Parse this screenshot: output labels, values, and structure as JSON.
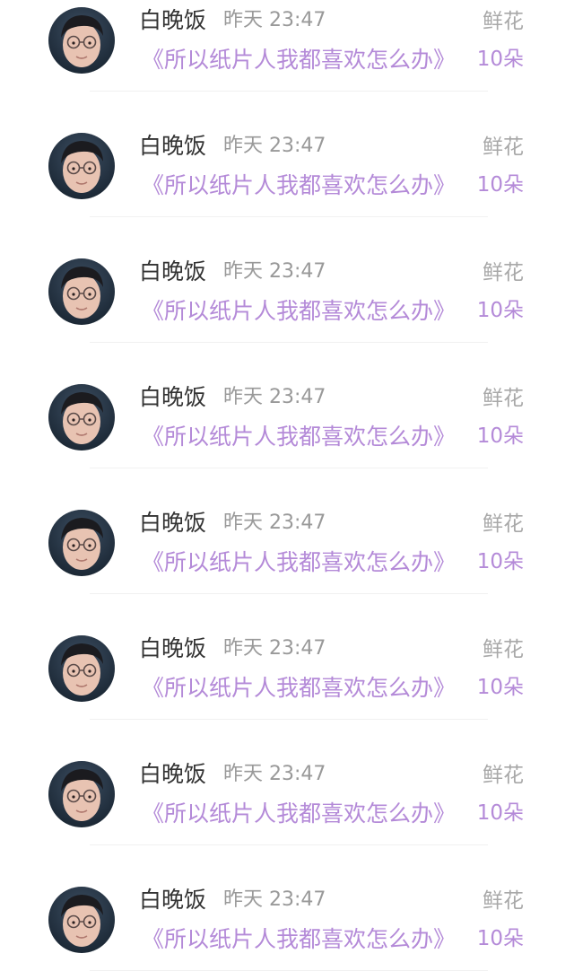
{
  "records": [
    {
      "user": "白晚饭",
      "time": "昨天 23:47",
      "book": "《所以纸片人我都喜欢怎么办》",
      "gift_label": "鲜花",
      "gift_count": "10朵",
      "avatar_icon": "user-avatar-icon"
    },
    {
      "user": "白晚饭",
      "time": "昨天 23:47",
      "book": "《所以纸片人我都喜欢怎么办》",
      "gift_label": "鲜花",
      "gift_count": "10朵",
      "avatar_icon": "user-avatar-icon"
    },
    {
      "user": "白晚饭",
      "time": "昨天 23:47",
      "book": "《所以纸片人我都喜欢怎么办》",
      "gift_label": "鲜花",
      "gift_count": "10朵",
      "avatar_icon": "user-avatar-icon"
    },
    {
      "user": "白晚饭",
      "time": "昨天 23:47",
      "book": "《所以纸片人我都喜欢怎么办》",
      "gift_label": "鲜花",
      "gift_count": "10朵",
      "avatar_icon": "user-avatar-icon"
    },
    {
      "user": "白晚饭",
      "time": "昨天 23:47",
      "book": "《所以纸片人我都喜欢怎么办》",
      "gift_label": "鲜花",
      "gift_count": "10朵",
      "avatar_icon": "user-avatar-icon"
    },
    {
      "user": "白晚饭",
      "time": "昨天 23:47",
      "book": "《所以纸片人我都喜欢怎么办》",
      "gift_label": "鲜花",
      "gift_count": "10朵",
      "avatar_icon": "user-avatar-icon"
    },
    {
      "user": "白晚饭",
      "time": "昨天 23:47",
      "book": "《所以纸片人我都喜欢怎么办》",
      "gift_label": "鲜花",
      "gift_count": "10朵",
      "avatar_icon": "user-avatar-icon"
    },
    {
      "user": "白晚饭",
      "time": "昨天 23:47",
      "book": "《所以纸片人我都喜欢怎么办》",
      "gift_label": "鲜花",
      "gift_count": "10朵",
      "avatar_icon": "user-avatar-icon"
    }
  ],
  "colors": {
    "name_text": "#333333",
    "meta_text": "#999999",
    "accent_purple": "#b48ad8",
    "divider": "#f1f1f1"
  }
}
